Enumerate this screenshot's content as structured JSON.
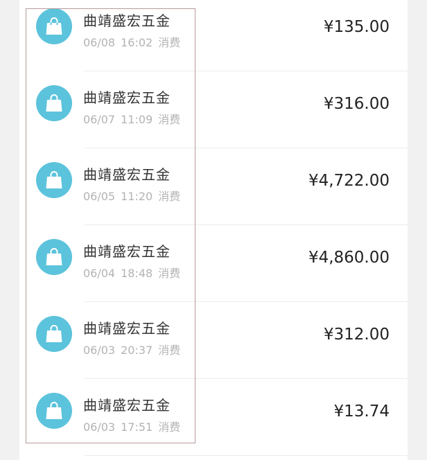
{
  "transactions": [
    {
      "merchant": "曲靖盛宏五金",
      "date": "06/08",
      "time": "16:02",
      "type": "消费",
      "amount": "¥135.00"
    },
    {
      "merchant": "曲靖盛宏五金",
      "date": "06/07",
      "time": "11:09",
      "type": "消费",
      "amount": "¥316.00"
    },
    {
      "merchant": "曲靖盛宏五金",
      "date": "06/05",
      "time": "11:20",
      "type": "消费",
      "amount": "¥4,722.00"
    },
    {
      "merchant": "曲靖盛宏五金",
      "date": "06/04",
      "time": "18:48",
      "type": "消费",
      "amount": "¥4,860.00"
    },
    {
      "merchant": "曲靖盛宏五金",
      "date": "06/03",
      "time": "20:37",
      "type": "消费",
      "amount": "¥312.00"
    },
    {
      "merchant": "曲靖盛宏五金",
      "date": "06/03",
      "time": "17:51",
      "type": "消费",
      "amount": "¥13.74"
    }
  ],
  "icons": {
    "merchant": "shopping-bag-icon"
  },
  "colors": {
    "icon_bg": "#5cc3dc",
    "highlight_border": "#b79a9a"
  }
}
